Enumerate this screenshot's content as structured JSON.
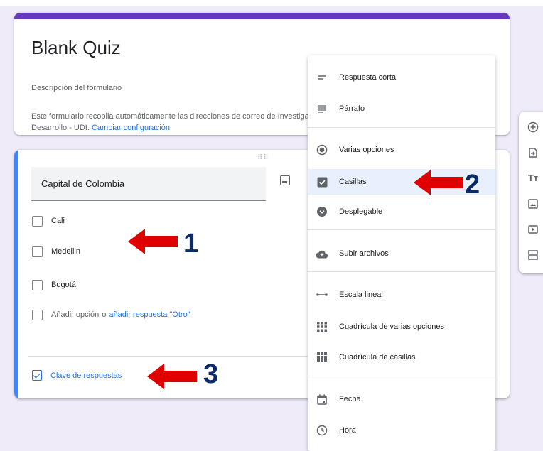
{
  "form": {
    "title": "Blank Quiz",
    "description": "Descripción del formulario",
    "notice_text": "Este formulario recopila automáticamente las direcciones de correo de Investigación y Desarrollo - UDI.",
    "notice_link": "Cambiar configuración"
  },
  "question": {
    "title": "Capital de Colombia",
    "options": [
      "Cali",
      "Medellin",
      "Bogotá"
    ],
    "add_option_label": "Añadir opción",
    "add_other_joiner": "o",
    "add_other_link": "añadir respuesta \"Otro\"",
    "answer_key_label": "Clave de respuestas"
  },
  "menu": {
    "items": [
      {
        "label": "Respuesta corta",
        "icon": "short-answer-icon"
      },
      {
        "label": "Párrafo",
        "icon": "paragraph-icon"
      },
      {
        "label": "Varias opciones",
        "icon": "radio-icon"
      },
      {
        "label": "Casillas",
        "icon": "checkbox-icon",
        "selected": true
      },
      {
        "label": "Desplegable",
        "icon": "dropdown-icon"
      },
      {
        "label": "Subir archivos",
        "icon": "cloud-upload-icon"
      },
      {
        "label": "Escala lineal",
        "icon": "linear-scale-icon"
      },
      {
        "label": "Cuadrícula de varias opciones",
        "icon": "grid-icon"
      },
      {
        "label": "Cuadrícula de casillas",
        "icon": "checkbox-grid-icon"
      },
      {
        "label": "Fecha",
        "icon": "calendar-icon"
      },
      {
        "label": "Hora",
        "icon": "clock-icon"
      }
    ]
  },
  "annotations": {
    "arrow1": "1",
    "arrow2": "2",
    "arrow3": "3"
  },
  "toolbar": {
    "icons": [
      "add-question-icon",
      "import-questions-icon",
      "add-title-icon",
      "add-image-icon",
      "add-video-icon",
      "add-section-icon"
    ]
  },
  "colors": {
    "accent": "#673ab7",
    "question_bar": "#4285f4",
    "link": "#1a73e8",
    "arrow": "#e00000",
    "annotation_number": "#0b2b6b"
  }
}
